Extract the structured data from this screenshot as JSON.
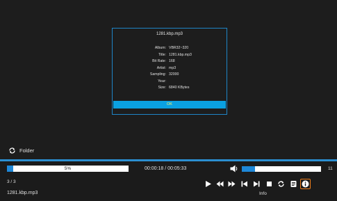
{
  "dialog": {
    "title": "1281.kbp.mp3",
    "rows": [
      {
        "label": "Album:",
        "value": "VBR32~320"
      },
      {
        "label": "Title:",
        "value": "1281.kbp.mp3"
      },
      {
        "label": "Bit Rate:",
        "value": "168"
      },
      {
        "label": "Artist:",
        "value": "mp3"
      },
      {
        "label": "Sampling:",
        "value": "32000"
      },
      {
        "label": "Year:",
        "value": ""
      },
      {
        "label": "Size:",
        "value": "6840 KBytes"
      }
    ],
    "ok_label": "OK"
  },
  "folder": {
    "label": "Folder",
    "icon": "refresh-icon"
  },
  "player": {
    "progress_fraction": 0.05,
    "progress_text": "5%",
    "time": "00:00:18 / 00:05:33",
    "volume_fraction": 0.17,
    "volume_level": "11",
    "track_count": "3 / 3",
    "file_name": "1281.kbp.mp3",
    "info_caption": "Info"
  },
  "colors": {
    "accent": "#1e88d8",
    "ok_button": "#0aa1e2",
    "ok_text": "#ffef60",
    "focus": "#ef7d1a",
    "background": "#1d1d1d"
  },
  "controls": [
    "play-icon",
    "rewind-icon",
    "fast-forward-icon",
    "previous-icon",
    "next-icon",
    "stop-icon",
    "repeat-icon",
    "playlist-icon",
    "info-icon"
  ]
}
